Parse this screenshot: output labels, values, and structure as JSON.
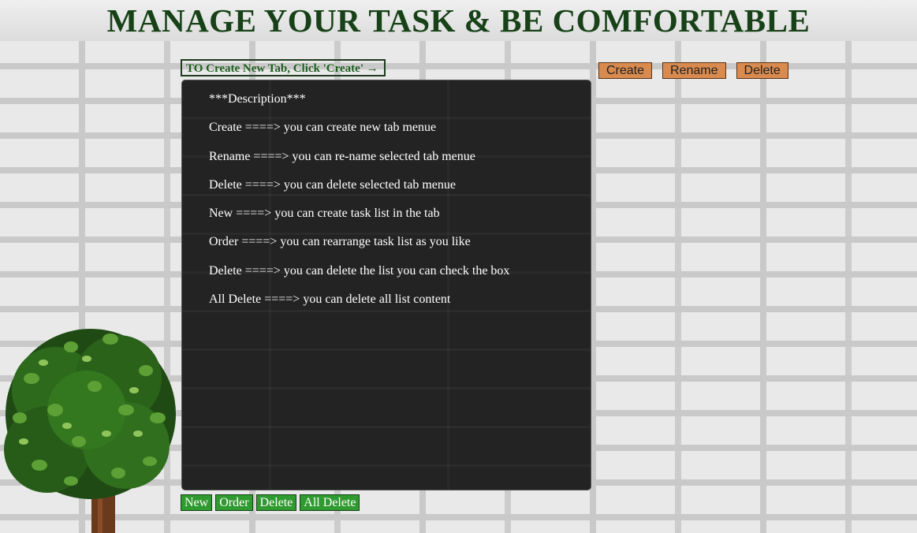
{
  "header": {
    "title": "MANAGE YOUR TASK & BE COMFORTABLE"
  },
  "hint": {
    "text": "TO Create New Tab, Click 'Create' →"
  },
  "tab_actions": {
    "create": "Create",
    "rename": "Rename",
    "delete": "Delete"
  },
  "description": {
    "heading": "***Description***",
    "items": [
      "Create ====> you can create new tab menue",
      "Rename ====> you can re-name selected tab menue",
      "Delete ====> you can delete selected tab menue",
      "New ====> you can create task list in the tab",
      "Order ====> you can rearrange task list as you like",
      "Delete ====> you can delete the list you can check the box",
      "All Delete ====> you can delete all list content"
    ]
  },
  "list_actions": {
    "new": "New",
    "order": "Order",
    "delete": "Delete",
    "all_delete": "All Delete"
  },
  "colors": {
    "title": "#174117",
    "tab_button": "#d98a4e",
    "list_button": "#2f9a2f",
    "panel": "#232323"
  }
}
